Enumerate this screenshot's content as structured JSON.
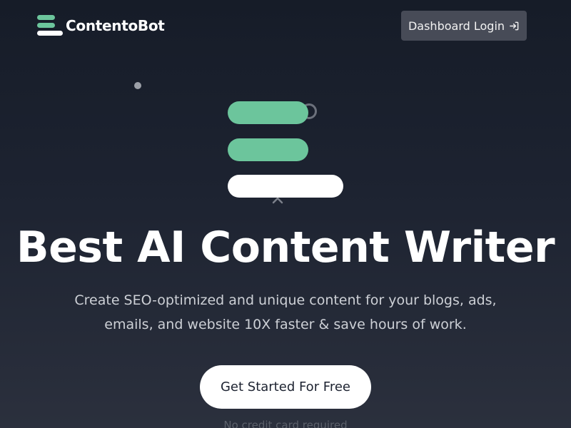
{
  "header": {
    "brand_name": "ContentoBot",
    "login_label": "Dashboard Login",
    "login_icon": "login-arrow-icon"
  },
  "hero": {
    "title": "Best AI Content Writer",
    "subtitle": "Create SEO-optimized and unique content for your blogs, ads, emails, and website 10X faster & save hours of work.",
    "cta_label": "Get Started For Free",
    "note": "No credit card required"
  },
  "colors": {
    "accent": "#6cc59c",
    "background": "#1d2331",
    "login_button": "#474b57",
    "cta_background": "#ffffff"
  }
}
